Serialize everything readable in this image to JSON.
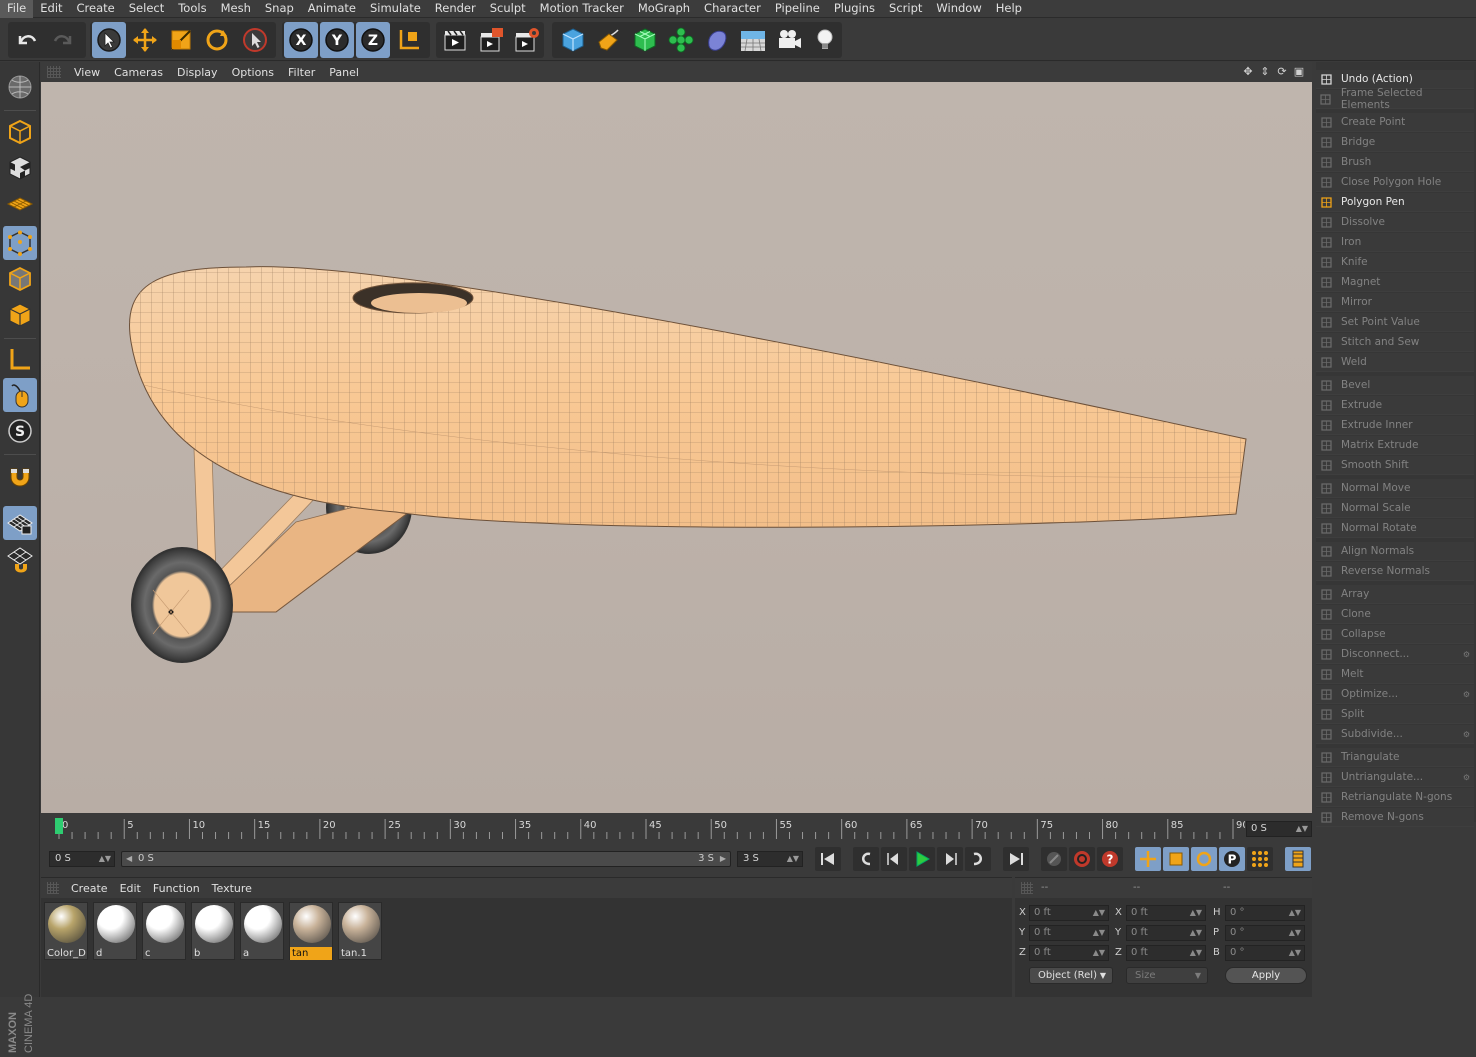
{
  "menu": [
    "File",
    "Edit",
    "Create",
    "Select",
    "Tools",
    "Mesh",
    "Snap",
    "Animate",
    "Simulate",
    "Render",
    "Sculpt",
    "Motion Tracker",
    "MoGraph",
    "Character",
    "Pipeline",
    "Plugins",
    "Script",
    "Window",
    "Help"
  ],
  "viewport": {
    "menu": [
      "View",
      "Cameras",
      "Display",
      "Options",
      "Filter",
      "Panel"
    ],
    "nav_icons": [
      "move-view-icon",
      "dolly-view-icon",
      "rotate-view-icon",
      "toggle-view-icon"
    ]
  },
  "commands": [
    {
      "label": "Undo (Action)",
      "enabled": true,
      "icon": "undo-icon"
    },
    {
      "label": "Frame Selected Elements",
      "enabled": false,
      "icon": "frame-icon"
    },
    {
      "label": "Create Point",
      "enabled": false,
      "icon": "point-icon"
    },
    {
      "label": "Bridge",
      "enabled": false,
      "icon": "bridge-icon"
    },
    {
      "label": "Brush",
      "enabled": false,
      "icon": "brush-icon"
    },
    {
      "label": "Close Polygon Hole",
      "enabled": false,
      "icon": "hole-icon"
    },
    {
      "label": "Polygon Pen",
      "enabled": true,
      "icon": "polygon-pen-icon"
    },
    {
      "label": "Dissolve",
      "enabled": false,
      "icon": "dissolve-icon"
    },
    {
      "label": "Iron",
      "enabled": false,
      "icon": "iron-icon"
    },
    {
      "label": "Knife",
      "enabled": false,
      "icon": "knife-icon"
    },
    {
      "label": "Magnet",
      "enabled": false,
      "icon": "magnet-icon"
    },
    {
      "label": "Mirror",
      "enabled": false,
      "icon": "mirror-icon"
    },
    {
      "label": "Set Point Value",
      "enabled": false,
      "icon": "set-point-icon"
    },
    {
      "label": "Stitch and Sew",
      "enabled": false,
      "icon": "stitch-icon"
    },
    {
      "label": "Weld",
      "enabled": false,
      "icon": "weld-icon"
    },
    {
      "label": "Bevel",
      "enabled": false,
      "icon": "bevel-icon"
    },
    {
      "label": "Extrude",
      "enabled": false,
      "icon": "extrude-icon"
    },
    {
      "label": "Extrude Inner",
      "enabled": false,
      "icon": "extrude-inner-icon"
    },
    {
      "label": "Matrix Extrude",
      "enabled": false,
      "icon": "matrix-extrude-icon"
    },
    {
      "label": "Smooth Shift",
      "enabled": false,
      "icon": "smooth-shift-icon"
    },
    {
      "label": "Normal Move",
      "enabled": false,
      "icon": "normal-move-icon"
    },
    {
      "label": "Normal Scale",
      "enabled": false,
      "icon": "normal-scale-icon"
    },
    {
      "label": "Normal Rotate",
      "enabled": false,
      "icon": "normal-rotate-icon"
    },
    {
      "label": "Align Normals",
      "enabled": false,
      "icon": "align-normals-icon"
    },
    {
      "label": "Reverse Normals",
      "enabled": false,
      "icon": "reverse-normals-icon"
    },
    {
      "label": "Array",
      "enabled": false,
      "icon": "array-icon"
    },
    {
      "label": "Clone",
      "enabled": false,
      "icon": "clone-icon"
    },
    {
      "label": "Collapse",
      "enabled": false,
      "icon": "collapse-icon"
    },
    {
      "label": "Disconnect...",
      "enabled": false,
      "icon": "disconnect-icon",
      "options": true
    },
    {
      "label": "Melt",
      "enabled": false,
      "icon": "melt-icon"
    },
    {
      "label": "Optimize...",
      "enabled": false,
      "icon": "optimize-icon",
      "options": true
    },
    {
      "label": "Split",
      "enabled": false,
      "icon": "split-icon"
    },
    {
      "label": "Subdivide...",
      "enabled": false,
      "icon": "subdivide-icon",
      "options": true
    },
    {
      "label": "Triangulate",
      "enabled": false,
      "icon": "triangulate-icon"
    },
    {
      "label": "Untriangulate...",
      "enabled": false,
      "icon": "untriangulate-icon",
      "options": true
    },
    {
      "label": "Retriangulate N-gons",
      "enabled": false,
      "icon": "retriangulate-icon"
    },
    {
      "label": "Remove N-gons",
      "enabled": false,
      "icon": "remove-ngons-icon"
    }
  ],
  "timeline": {
    "ticks": [
      "0",
      "5",
      "10",
      "15",
      "20",
      "25",
      "30",
      "35",
      "40",
      "45",
      "50",
      "55",
      "60",
      "65",
      "70",
      "75",
      "80",
      "85",
      "90"
    ],
    "current_frame": "0 S",
    "end_field": "0 S"
  },
  "transport": {
    "start": "0 S",
    "range_left": "0 S",
    "range_right": "3 S",
    "end": "3 S",
    "range_position": 0
  },
  "material_manager": {
    "menu": [
      "Create",
      "Edit",
      "Function",
      "Texture"
    ],
    "materials": [
      {
        "name": "Color_D",
        "color": "#b8a46a",
        "highlight": false
      },
      {
        "name": "d",
        "color": "#ffffff",
        "highlight": false
      },
      {
        "name": "c",
        "color": "#ffffff",
        "highlight": false
      },
      {
        "name": "b",
        "color": "#ffffff",
        "highlight": false
      },
      {
        "name": "a",
        "color": "#ffffff",
        "highlight": false
      },
      {
        "name": "tan",
        "color": "#c9b39a",
        "highlight": true
      },
      {
        "name": "tan.1",
        "color": "#c9b39a",
        "highlight": false
      }
    ]
  },
  "coordinates": {
    "headers": [
      "--",
      "--",
      "--"
    ],
    "rows": [
      {
        "l1": "X",
        "v1": "0 ft",
        "l2": "X",
        "v2": "0 ft",
        "l3": "H",
        "v3": "0 °"
      },
      {
        "l1": "Y",
        "v1": "0 ft",
        "l2": "Y",
        "v2": "0 ft",
        "l3": "P",
        "v3": "0 °"
      },
      {
        "l1": "Z",
        "v1": "0 ft",
        "l2": "Z",
        "v2": "0 ft",
        "l3": "B",
        "v3": "0 °"
      }
    ],
    "mode": "Object (Rel)",
    "size_mode": "Size",
    "apply": "Apply"
  },
  "brand": {
    "company": "MAXON",
    "product": "CINEMA 4D"
  },
  "colors": {
    "accent_orange": "#f0a418",
    "selection_blue": "#7e9fc7",
    "model_color": "#f4c9a0",
    "viewport_bg": "#bdb2aa"
  }
}
